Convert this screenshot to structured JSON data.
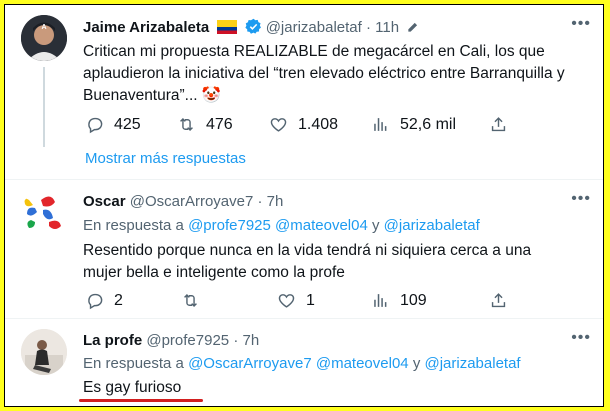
{
  "colors": {
    "background": "#ffff1e",
    "link": "#1d9bf0",
    "muted": "#536471",
    "verified": "#1d9bf0",
    "underline": "#d21f1f"
  },
  "tweet1": {
    "name": "Jaime Arizabaleta",
    "flag": "flag-colombia-icon",
    "handle": "@jarizabaletaf",
    "time": "11h",
    "text": "Critican mi propuesta REALIZABLE de megacárcel en Cali, los que aplaudieron la iniciativa del “tren elevado eléctrico  entre Barranquilla y Buenaventura”... 🤡",
    "replies": "425",
    "retweets": "476",
    "likes": "1.408",
    "views": "52,6 mil"
  },
  "show_more": "Mostrar más respuestas",
  "tweet2": {
    "name": "Oscar",
    "handle": "@OscarArroyave7",
    "time": "7h",
    "reply_prefix": "En respuesta a",
    "reply_to_1": "@profe7925",
    "reply_to_2": "@mateovel04",
    "reply_and": "y",
    "reply_to_3": "@jarizabaletaf",
    "text": "Resentido porque nunca en la vida tendrá ni siquiera cerca a una mujer bella e inteligente como la profe",
    "replies": "2",
    "retweets": "",
    "likes": "1",
    "views": "109"
  },
  "tweet3": {
    "name": "La profe",
    "handle": "@profe7925",
    "time": "7h",
    "reply_prefix": "En respuesta a",
    "reply_to_1": "@OscarArroyave7",
    "reply_to_2": "@mateovel04",
    "reply_and": "y",
    "reply_to_3": "@jarizabaletaf",
    "text": "Es gay furioso"
  },
  "sep": "·"
}
